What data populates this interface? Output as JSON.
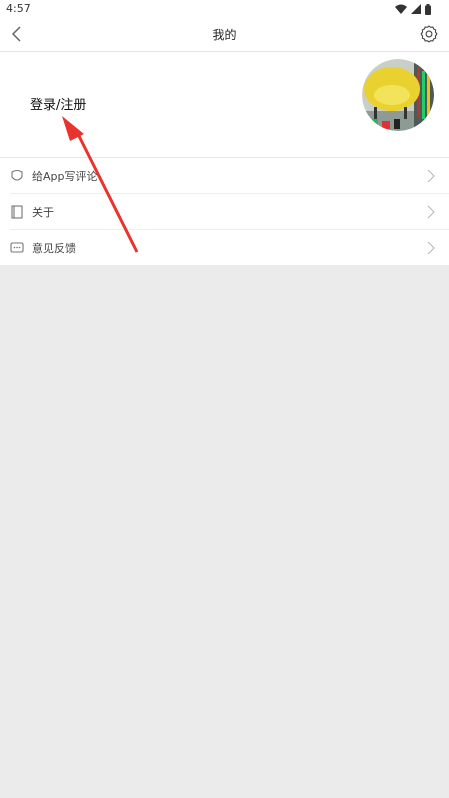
{
  "status_bar": {
    "time": "4:57"
  },
  "nav": {
    "title": "我的",
    "back_icon": "chevron-left-icon",
    "settings_icon": "gear-icon"
  },
  "profile": {
    "login_label": "登录/注册"
  },
  "menu": {
    "items": [
      {
        "label": "给App写评论",
        "icon": "badge-icon"
      },
      {
        "label": "关于",
        "icon": "book-icon"
      },
      {
        "label": "意见反馈",
        "icon": "chat-icon"
      }
    ]
  },
  "colors": {
    "annotation_arrow": "#e8332f",
    "background": "#ebebeb"
  }
}
